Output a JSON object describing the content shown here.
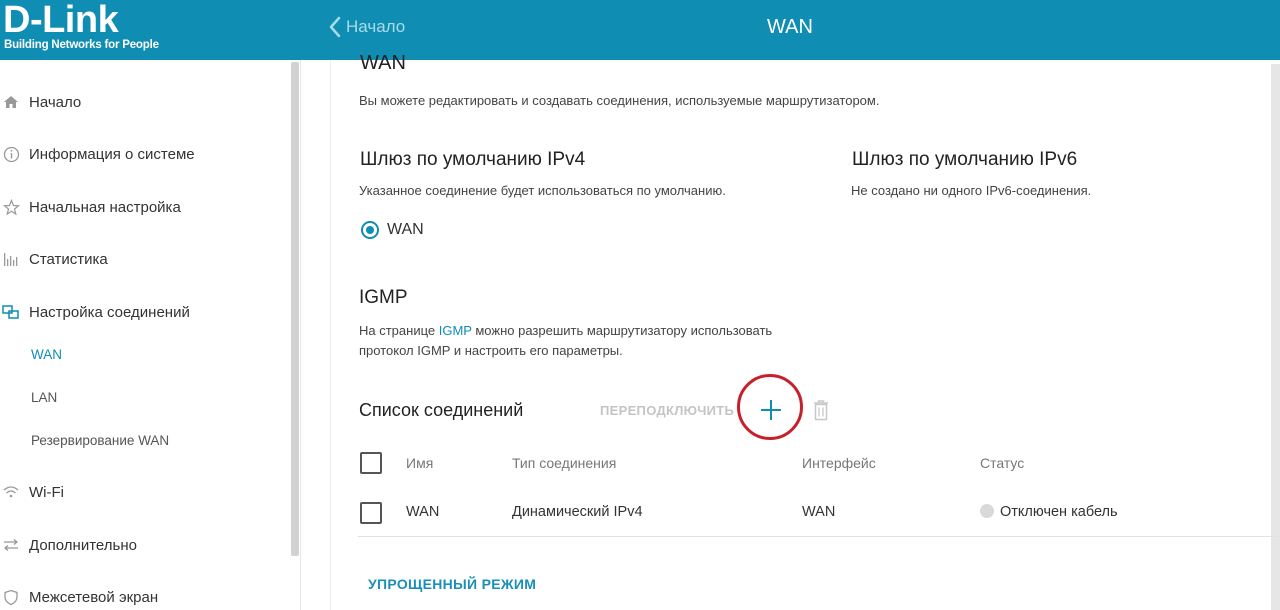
{
  "brand": {
    "name": "D-Link",
    "tagline": "Building Networks for People"
  },
  "header": {
    "back_label": "Начало",
    "title": "WAN"
  },
  "sidebar": {
    "items": [
      {
        "label": "Начало",
        "icon": "home-icon"
      },
      {
        "label": "Информация о системе",
        "icon": "info-icon"
      },
      {
        "label": "Начальная настройка",
        "icon": "star-icon"
      },
      {
        "label": "Статистика",
        "icon": "bar-chart-icon"
      },
      {
        "label": "Настройка соединений",
        "icon": "connections-icon"
      },
      {
        "label": "Wi-Fi",
        "icon": "wifi-icon"
      },
      {
        "label": "Дополнительно",
        "icon": "arrows-icon"
      },
      {
        "label": "Межсетевой экран",
        "icon": "shield-icon"
      }
    ],
    "sub_items": [
      "WAN",
      "LAN",
      "Резервирование WAN"
    ]
  },
  "main": {
    "section_title": "WAN",
    "section_desc": "Вы можете редактировать и создавать соединения, используемые маршрутизатором.",
    "ipv4": {
      "title": "Шлюз по умолчанию IPv4",
      "desc": "Указанное соединение будет использоваться по умолчанию.",
      "radio_label": "WAN"
    },
    "ipv6": {
      "title": "Шлюз по умолчанию IPv6",
      "desc": "Не создано ни одного IPv6-соединения."
    },
    "igmp": {
      "title": "IGMP",
      "desc_before": "На странице ",
      "desc_link": "IGMP",
      "desc_after_line1": " можно разрешить маршрутизатору использовать",
      "desc_line2": "протокол IGMP и настроить его параметры."
    },
    "connections": {
      "title": "Список соединений",
      "reconnect_label": "ПЕРЕПОДКЛЮЧИТЬ",
      "columns": [
        "Имя",
        "Тип соединения",
        "Интерфейс",
        "Статус"
      ],
      "rows": [
        {
          "name": "WAN",
          "type": "Динамический IPv4",
          "interface": "WAN",
          "status": "Отключен кабель"
        }
      ]
    },
    "simple_mode_label": "УПРОЩЕННЫЙ РЕЖИМ"
  },
  "colors": {
    "accent": "#0f8db3",
    "highlight_circle": "#c8202a"
  }
}
